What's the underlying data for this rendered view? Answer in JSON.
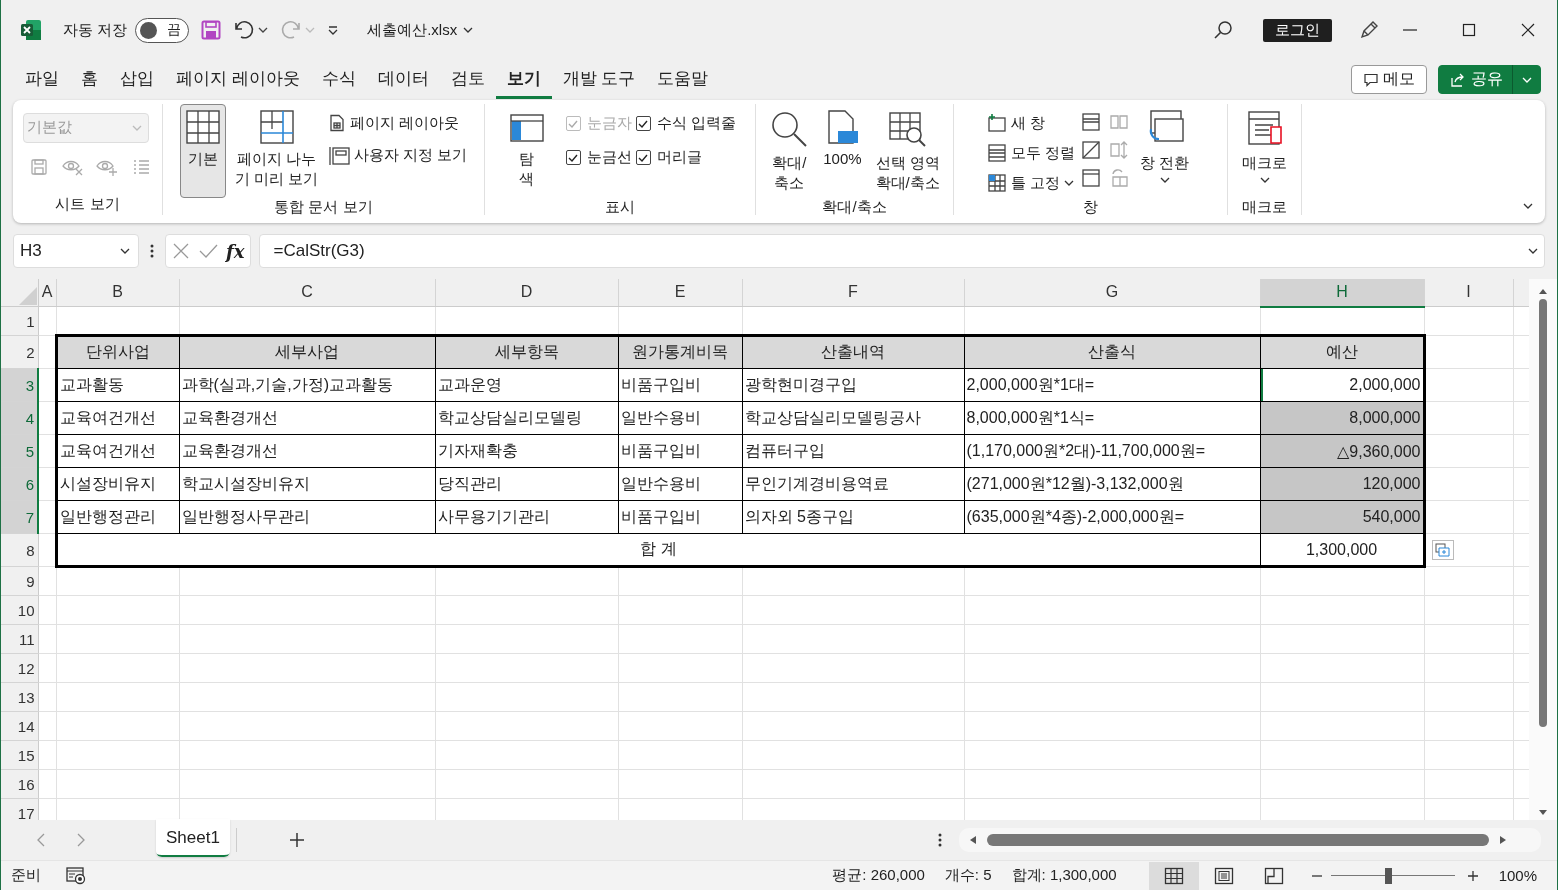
{
  "title_bar": {
    "autosave_label": "자동 저장",
    "autosave_toggle": {
      "label": "끔",
      "on": false
    },
    "filename": "세출예산.xlsx",
    "sign_in": "로그인"
  },
  "menu_tabs": [
    {
      "label": "파일",
      "selected": false
    },
    {
      "label": "홈",
      "selected": false
    },
    {
      "label": "삽입",
      "selected": false
    },
    {
      "label": "페이지 레이아웃",
      "selected": false
    },
    {
      "label": "수식",
      "selected": false
    },
    {
      "label": "데이터",
      "selected": false
    },
    {
      "label": "검토",
      "selected": false
    },
    {
      "label": "보기",
      "selected": true
    },
    {
      "label": "개발 도구",
      "selected": false
    },
    {
      "label": "도움말",
      "selected": false
    }
  ],
  "menu_buttons": [
    {
      "label": "메모",
      "kind": "comments"
    },
    {
      "label": "공유",
      "kind": "share"
    }
  ],
  "ribbon": {
    "groups": [
      {
        "label": "시트 보기",
        "items": [
          {
            "kind": "stack",
            "items": [
              {
                "kind": "combo",
                "value": "기본값",
                "disabled": true
              },
              {
                "kind": "row",
                "items": [
                  {
                    "kind": "icon",
                    "disabled": true
                  },
                  {
                    "kind": "icon",
                    "disabled": true
                  },
                  {
                    "kind": "icon",
                    "disabled": true
                  },
                  {
                    "kind": "icon",
                    "disabled": true
                  }
                ]
              }
            ]
          }
        ]
      },
      {
        "label": "통합 문서 보기",
        "items": [
          {
            "kind": "large",
            "label": "기본",
            "selected": true
          },
          {
            "kind": "large",
            "label": "페이지 나누\n기 미리 보기",
            "selected": false
          },
          {
            "kind": "stack",
            "items": [
              {
                "kind": "small",
                "label": "페이지 레이아웃"
              },
              {
                "kind": "small",
                "label": "사용자 지정 보기"
              }
            ]
          }
        ]
      },
      {
        "label": "표시",
        "items": [
          {
            "kind": "large",
            "label": "탐\n색",
            "selected": false
          },
          {
            "kind": "stack",
            "items": [
              {
                "kind": "check",
                "label": "눈금자",
                "checked": true,
                "disabled": true
              },
              {
                "kind": "check",
                "label": "눈금선",
                "checked": true,
                "disabled": false
              }
            ]
          },
          {
            "kind": "stack",
            "items": [
              {
                "kind": "check",
                "label": "수식 입력줄",
                "checked": true,
                "disabled": false
              },
              {
                "kind": "check",
                "label": "머리글",
                "checked": true,
                "disabled": false
              }
            ]
          }
        ]
      },
      {
        "label": "확대/축소",
        "items": [
          {
            "kind": "large",
            "label": "확대/\n축소",
            "selected": false
          },
          {
            "kind": "large",
            "label": "100%",
            "selected": false
          },
          {
            "kind": "large",
            "label": "선택 영역\n확대/축소",
            "selected": false
          }
        ]
      },
      {
        "label": "창",
        "items": [
          {
            "kind": "stack",
            "items": [
              {
                "kind": "small",
                "label": "새 창"
              },
              {
                "kind": "small",
                "label": "모두 정렬"
              },
              {
                "kind": "small",
                "label": "틀 고정",
                "dropdown": true
              }
            ]
          },
          {
            "kind": "stack",
            "items": [
              {
                "kind": "icon",
                "disabled": false
              },
              {
                "kind": "icon",
                "disabled": false
              },
              {
                "kind": "icon",
                "disabled": false
              }
            ]
          },
          {
            "kind": "stack",
            "items": [
              {
                "kind": "icon",
                "disabled": true
              },
              {
                "kind": "icon",
                "disabled": true
              },
              {
                "kind": "icon",
                "disabled": true
              }
            ]
          },
          {
            "kind": "large",
            "label": "창 전환",
            "selected": false,
            "dropdown": true
          }
        ]
      },
      {
        "label": "매크로",
        "items": [
          {
            "kind": "large",
            "label": "매크로",
            "selected": false,
            "dropdown": true
          }
        ]
      }
    ]
  },
  "formula_bar": {
    "name_box": "H3",
    "function_label": "fx",
    "formula": "=CalStr(G3)"
  },
  "sheet": {
    "columns": [
      {
        "label": "A",
        "selected": false
      },
      {
        "label": "B",
        "selected": false
      },
      {
        "label": "C",
        "selected": false
      },
      {
        "label": "D",
        "selected": false
      },
      {
        "label": "E",
        "selected": false
      },
      {
        "label": "F",
        "selected": false
      },
      {
        "label": "G",
        "selected": false
      },
      {
        "label": "H",
        "selected": true
      },
      {
        "label": "I",
        "selected": false
      }
    ],
    "rows": [
      {
        "number": "1",
        "kind": "empty",
        "selected": false
      },
      {
        "number": "2",
        "kind": "header",
        "selected": false,
        "cells": [
          "단위사업",
          "세부사업",
          "세부항목",
          "원가통계비목",
          "산출내역",
          "산출식",
          "예산"
        ]
      },
      {
        "number": "3",
        "kind": "item",
        "selected": true,
        "active": true,
        "cells": [
          "교과활동",
          "과학(실과,기술,가정)교과활동",
          "교과운영",
          "비품구입비",
          "광학현미경구입",
          "2,000,000원*1대=",
          "2,000,000"
        ]
      },
      {
        "number": "4",
        "kind": "item",
        "selected": true,
        "cells": [
          "교육여건개선",
          "교육환경개선",
          "학교상담실리모델링",
          "일반수용비",
          "학교상담실리모델링공사",
          "8,000,000원*1식=",
          "8,000,000"
        ]
      },
      {
        "number": "5",
        "kind": "item",
        "selected": true,
        "cells": [
          "교육여건개선",
          "교육환경개선",
          "기자재확충",
          "비품구입비",
          "컴퓨터구입",
          "(1,170,000원*2대)-11,700,000원=",
          "△9,360,000"
        ]
      },
      {
        "number": "6",
        "kind": "item",
        "selected": true,
        "cells": [
          "시설장비유지",
          "학교시설장비유지",
          "당직관리",
          "일반수용비",
          "무인기계경비용역료",
          "(271,000원*12월)-3,132,000원",
          "120,000"
        ]
      },
      {
        "number": "7",
        "kind": "item",
        "selected": true,
        "cells": [
          "일반행정관리",
          "일반행정사무관리",
          "사무용기기관리",
          "비품구입비",
          "의자외 5종구입",
          "(635,000원*4종)-2,000,000원=",
          "540,000"
        ]
      },
      {
        "number": "8",
        "kind": "total",
        "selected": false,
        "cells": [
          "합 계",
          "1,300,000"
        ]
      },
      {
        "number": "9",
        "kind": "empty",
        "selected": false
      },
      {
        "number": "10",
        "kind": "empty",
        "selected": false
      },
      {
        "number": "11",
        "kind": "empty",
        "selected": false
      },
      {
        "number": "12",
        "kind": "empty",
        "selected": false
      },
      {
        "number": "13",
        "kind": "empty",
        "selected": false
      },
      {
        "number": "14",
        "kind": "empty",
        "selected": false
      },
      {
        "number": "15",
        "kind": "empty",
        "selected": false
      },
      {
        "number": "16",
        "kind": "empty",
        "selected": false
      },
      {
        "number": "17",
        "kind": "empty",
        "selected": false
      }
    ]
  },
  "sheet_tabs": [
    {
      "label": "Sheet1",
      "selected": true
    }
  ],
  "status_bar": {
    "mode": "준비",
    "stats": [
      "평균: 260,000",
      "개수: 5",
      "합계: 1,300,000"
    ],
    "views": [
      {
        "kind": "normal",
        "selected": true
      },
      {
        "kind": "page-layout",
        "selected": false
      },
      {
        "kind": "page-break",
        "selected": false
      }
    ],
    "zoom": {
      "level": 0.47,
      "reading": "100%"
    }
  }
}
